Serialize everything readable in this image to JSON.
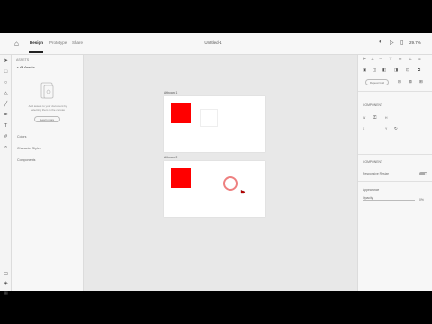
{
  "topbar": {
    "home_icon": "home-icon",
    "tabs": [
      {
        "label": "Design",
        "active": true
      },
      {
        "label": "Prototype",
        "active": false
      },
      {
        "label": "Share",
        "active": false
      }
    ],
    "document_title": "Untitled-1",
    "zoom": "29.7%"
  },
  "layers_panel": {
    "heading": "ASSETS",
    "filter": "All Assets",
    "empty_message": "Add assets to your document by selecting them in the canvas",
    "learn_more": "Learn more",
    "sections": [
      "Colors",
      "Character Styles",
      "Components"
    ]
  },
  "canvas": {
    "artboards": [
      {
        "label": "Artboard 1",
        "rect_color": "#ff0000"
      },
      {
        "label": "Artboard 2",
        "rect_color": "#ff0000"
      }
    ]
  },
  "properties": {
    "repeat_grid": "Repeat Grid",
    "section_component": "COMPONENT",
    "responsive_resize": "Responsive Resize",
    "section_appearance": "Appearance",
    "opacity_label": "Opacity",
    "opacity_value": "0%",
    "fields": [
      "W",
      "H",
      "X",
      "Y"
    ]
  },
  "colors": {
    "accent": "#ff0000",
    "ring": "#ee8080"
  }
}
